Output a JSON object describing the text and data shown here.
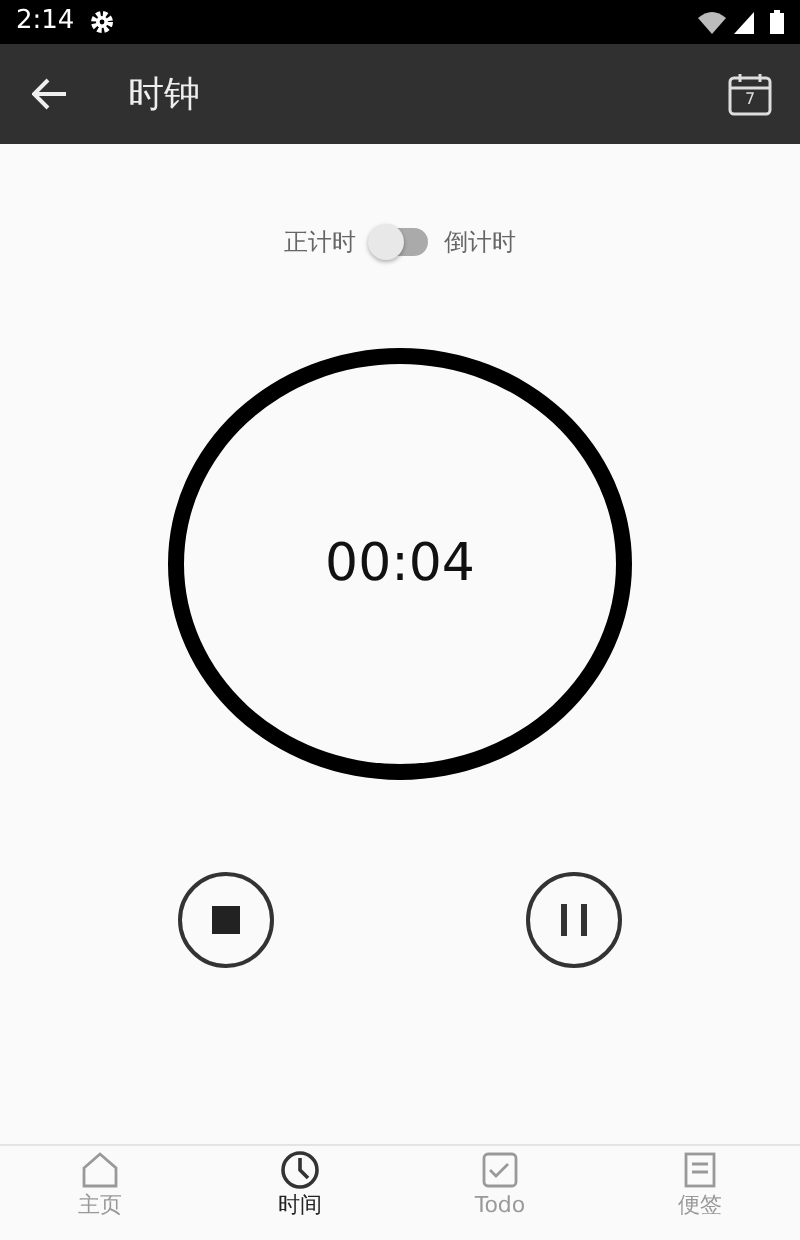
{
  "status_bar": {
    "time": "2:14"
  },
  "app_bar": {
    "title": "时钟",
    "calendar_day": "7"
  },
  "mode_switch": {
    "left_label": "正计时",
    "right_label": "倒计时",
    "checked": false
  },
  "timer": {
    "display": "00:04"
  },
  "controls": [
    {
      "kind": "stop"
    },
    {
      "kind": "pause"
    }
  ],
  "bottom_nav": [
    {
      "kind": "home",
      "label": "主页",
      "selected": false
    },
    {
      "kind": "clock",
      "label": "时间",
      "selected": true
    },
    {
      "kind": "todo",
      "label": "Todo",
      "selected": false
    },
    {
      "kind": "note",
      "label": "便签",
      "selected": false
    }
  ]
}
